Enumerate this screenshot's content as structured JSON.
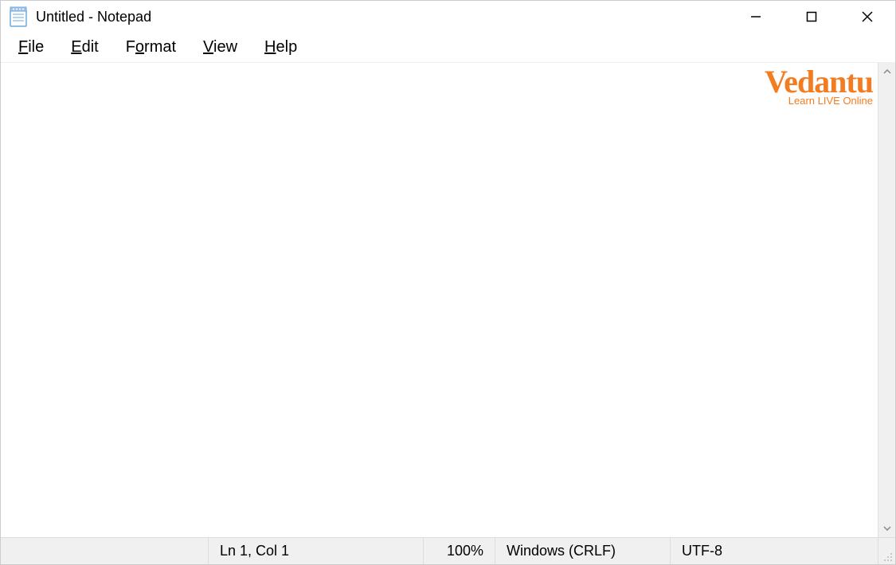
{
  "window": {
    "title": "Untitled - Notepad"
  },
  "menu": {
    "file": "File",
    "edit": "Edit",
    "format": "Format",
    "format_pre": "F",
    "format_u": "o",
    "format_post": "rmat",
    "view": "View",
    "help": "Help"
  },
  "content": {
    "text": ""
  },
  "watermark": {
    "logo": "Vedantu",
    "tagline": "Learn LIVE Online"
  },
  "status": {
    "position": "Ln 1, Col 1",
    "zoom": "100%",
    "line_ending": "Windows (CRLF)",
    "encoding": "UTF-8"
  }
}
